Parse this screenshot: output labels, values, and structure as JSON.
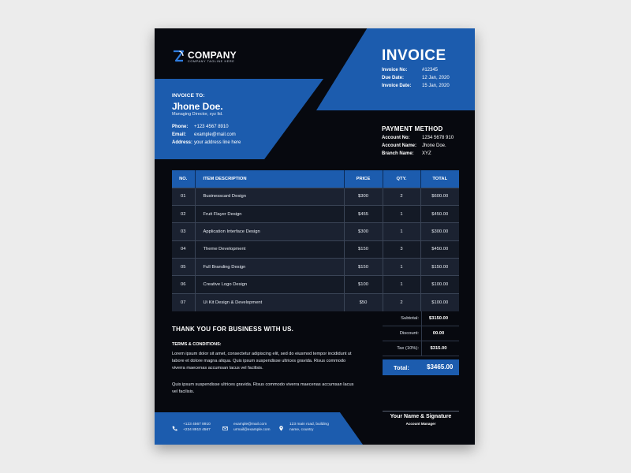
{
  "brand": {
    "name": "COMPANY",
    "tagline": "COMPANY TAGLINE HERE",
    "accent_color": "#1c5cae",
    "background_color": "#07090f"
  },
  "invoice": {
    "title": "INVOICE",
    "fields": [
      {
        "label": "Invoice No:",
        "value": "#12345"
      },
      {
        "label": "Due Date:",
        "value": "12 Jan, 2020"
      },
      {
        "label": "Invoice Date:",
        "value": "15 Jan, 2020"
      }
    ]
  },
  "client": {
    "section_label": "INVOICE TO:",
    "name": "Jhone Doe.",
    "role": "Managing Director, xyz ltd.",
    "fields": [
      {
        "label": "Phone:",
        "value": "+123 4567 8910"
      },
      {
        "label": "Email:",
        "value": "example@mail.com"
      },
      {
        "label": "Address:",
        "value": "your address line here"
      }
    ]
  },
  "payment": {
    "title": "PAYMENT METHOD",
    "fields": [
      {
        "label": "Account No:",
        "value": "1234 5678 910"
      },
      {
        "label": "Account Name:",
        "value": "Jhone Doe."
      },
      {
        "label": "Branch Name:",
        "value": "XYZ"
      }
    ]
  },
  "items_table": {
    "headers": [
      "NO.",
      "ITEM DESCRIPTION",
      "PRICE",
      "QTY.",
      "TOTAL"
    ],
    "rows": [
      [
        "01",
        "Businesscard Design",
        "$300",
        "2",
        "$600.00"
      ],
      [
        "02",
        "Fruit Flayer Design",
        "$455",
        "1",
        "$450.00"
      ],
      [
        "03",
        "Application Interface Design",
        "$300",
        "1",
        "$300.00"
      ],
      [
        "04",
        "Theme Development",
        "$150",
        "3",
        "$450.00"
      ],
      [
        "05",
        "Full Branding Design",
        "$150",
        "1",
        "$150.00"
      ],
      [
        "06",
        "Creative Logo Design",
        "$100",
        "1",
        "$100.00"
      ],
      [
        "07",
        "Ui Kit Design & Development",
        "$50",
        "2",
        "$100.00"
      ]
    ]
  },
  "totals": {
    "rows": [
      {
        "label": "Subtotal:",
        "value": "$3150.00"
      },
      {
        "label": "Discount:",
        "value": "00.00"
      },
      {
        "label": "Tax (10%):",
        "value": "$315.00"
      }
    ],
    "grand_label": "Total:",
    "grand_value": "$3465.00"
  },
  "notes": {
    "thanks": "THANK YOU FOR BUSINESS WITH US.",
    "terms_title": "TERMS & CONDITIONS:",
    "paragraph_1": "Lorem ipsum dolor sit amet, consectetur adipiscing elit, sed do eiusmod tempor incididunt ut labore et dolore magna aliqua. Quis ipsum suspendisse ultrices gravida. Risus commodo viverra maecenas accumsan lacus vel facilisis.",
    "paragraph_2": "Quis ipsum suspendisse ultrices gravida. Risus commodo viverra maecenas accumsan lacus vel facilisis."
  },
  "signature": {
    "name": "Your Name & Signature",
    "role": "Account Manager"
  },
  "footer": {
    "phone": [
      "+123 4567 8910",
      "+234 8910 4567"
    ],
    "email": [
      "example@mail.com",
      "urmail@example.com"
    ],
    "address": [
      "123 main road, building",
      "name, country"
    ],
    "icons": [
      "phone-icon",
      "mail-icon",
      "location-icon"
    ]
  }
}
